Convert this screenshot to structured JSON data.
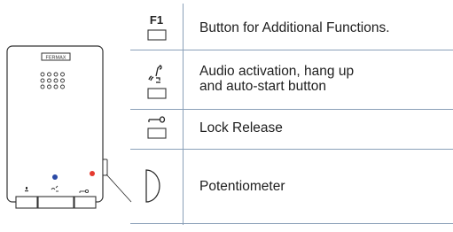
{
  "device": {
    "brand": "FERMAX",
    "led_blue": "#2b4aa6",
    "led_red": "#e53a2f",
    "button_symbols": [
      "F1",
      "audio",
      "lock"
    ]
  },
  "legend": {
    "items": [
      {
        "icon": "f1-button-icon",
        "icon_text": "F1",
        "label": "Button for Additional Functions."
      },
      {
        "icon": "audio-handset-icon",
        "icon_text": "",
        "label_lines": [
          "Audio activation, hang up",
          "and auto-start button"
        ]
      },
      {
        "icon": "key-icon",
        "icon_text": "",
        "label": "Lock Release"
      },
      {
        "icon": "potentiometer-icon",
        "icon_text": "",
        "label": "Potentiometer"
      }
    ]
  },
  "colors": {
    "rule_line": "#8aa0b8",
    "outline": "#333333"
  }
}
